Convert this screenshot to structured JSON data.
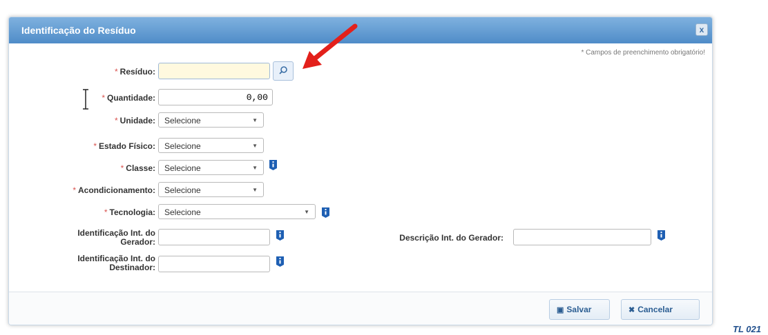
{
  "dialog": {
    "title": "Identificação do Resíduo",
    "close_label": "x",
    "required_note": "* Campos de preenchimento obrigatório!"
  },
  "form": {
    "required_mark": "*",
    "residuo": {
      "label": "Resíduo:",
      "value": ""
    },
    "quantidade": {
      "label": "Quantidade:",
      "value": "0,00"
    },
    "unidade": {
      "label": "Unidade:",
      "selected": "Selecione"
    },
    "estado_fisico": {
      "label": "Estado Físico:",
      "selected": "Selecione"
    },
    "classe": {
      "label": "Classe:",
      "selected": "Selecione"
    },
    "acondicionamento": {
      "label": "Acondicionamento:",
      "selected": "Selecione"
    },
    "tecnologia": {
      "label": "Tecnologia:",
      "selected": "Selecione"
    },
    "id_gerador": {
      "label_line1": "Identificação Int. do",
      "label_line2": "Gerador:",
      "value": ""
    },
    "id_destinador": {
      "label_line1": "Identificação Int. do",
      "label_line2": "Destinador:",
      "value": ""
    },
    "descricao_gerador": {
      "label": "Descrição Int. do Gerador:",
      "value": ""
    }
  },
  "footer": {
    "save_label": "Salvar",
    "cancel_label": "Cancelar"
  },
  "annotation": {
    "tag": "TL 021"
  },
  "colors": {
    "titlebar": "#4f8cc8",
    "required_star": "#d9534f",
    "info_icon": "#1e5fb3",
    "arrow": "#e3201b"
  },
  "icons": [
    "search-icon",
    "info-icon",
    "save-icon",
    "cancel-icon",
    "close-icon",
    "chevron-down-icon"
  ]
}
